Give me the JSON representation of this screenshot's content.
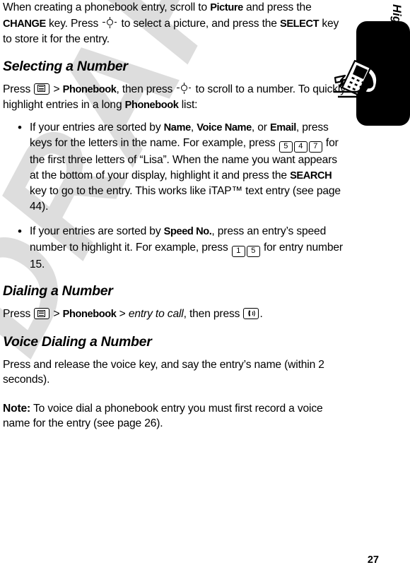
{
  "page": {
    "number": "27",
    "watermark": "DRAFT",
    "side_tab_label": "Highlight Features"
  },
  "icons": {
    "menu_key": "menu-key-icon",
    "nav_key": "navigation-key-icon",
    "send_key": "send-call-key-icon",
    "phone_illustration": "running-phone-icon",
    "key_5": "5",
    "key_4": "4",
    "key_7": "7",
    "key_1": "1",
    "key_1b": "5"
  },
  "intro": {
    "t1": "When creating a phonebook entry, scroll to ",
    "label_picture": "Picture",
    "t2": " and press the ",
    "label_change": "CHANGE",
    "t3": " key. Press ",
    "t4": " to select a picture, and press the ",
    "label_select": "SELECT",
    "t5": " key to store it for the entry."
  },
  "sections": [
    {
      "heading": "Selecting a Number",
      "intro": {
        "t1": "Press ",
        "t2": " > ",
        "label_phonebook": "Phonebook",
        "t3": ", then press ",
        "t4": " to scroll to a number. To quickly highlight entries in a long ",
        "label_phonebook2": "Phonebook",
        "t5": " list:"
      },
      "bullets": [
        {
          "t1": "If your entries are sorted by ",
          "label_name": "Name",
          "t2": ", ",
          "label_voice_name": "Voice Name",
          "t3": ", or ",
          "label_email": "Email",
          "t4": ", press keys for the letters in the name. For example, press ",
          "t5": " for the first three letters of “Lisa”. When the name you want appears at the bottom of your display, highlight it and press the ",
          "label_search": "SEARCH",
          "t6": " key to go to the entry. This works like iTAP™ text entry (see page 44)."
        },
        {
          "t1": "If your entries are sorted by ",
          "label_speed_no": "Speed No.",
          "t2": ", press an entry’s speed number to highlight it. For example, press ",
          "t3": " for entry number 15."
        }
      ]
    },
    {
      "heading": "Dialing a Number",
      "body": {
        "t1": "Press ",
        "t2": " > ",
        "label_phonebook": "Phonebook",
        "t3": " > ",
        "italic_entry": "entry to call",
        "t4": ", then press ",
        "t5": "."
      }
    },
    {
      "heading": "Voice Dialing a Number",
      "body": {
        "t1": "Press and release the voice key, and say the entry’s name (within 2 seconds)."
      },
      "note": {
        "lead": "Note:",
        "text": " To voice dial a phonebook entry you must first record a voice name for the entry (see page 26)."
      }
    }
  ]
}
